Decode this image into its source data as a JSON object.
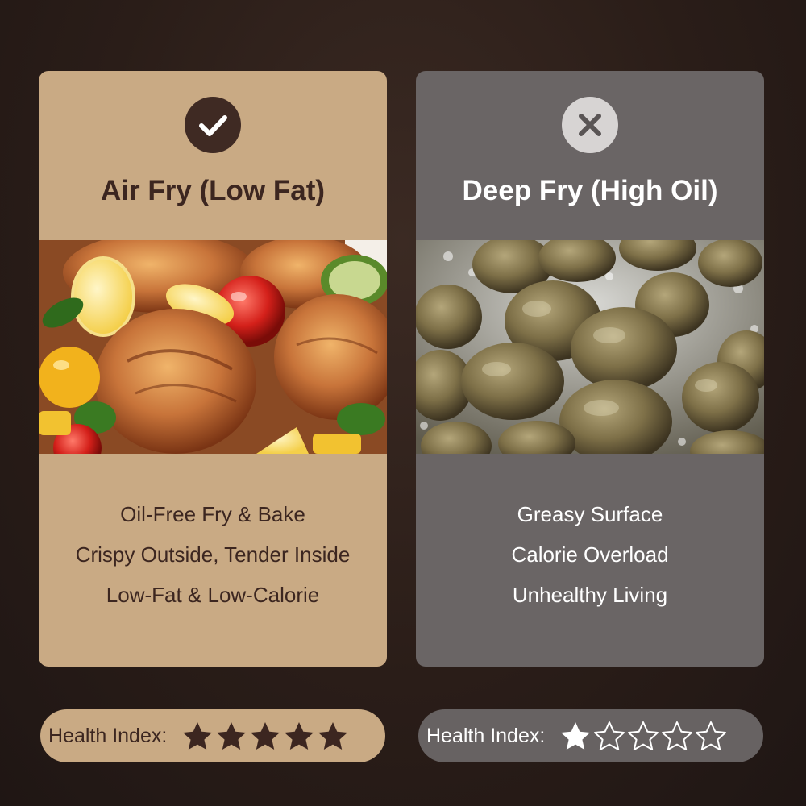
{
  "cards": {
    "good": {
      "badge_icon": "checkmark-icon",
      "title": "Air Fry (Low Fat)",
      "image_subject": "roasted-chicken-photo",
      "features": [
        "Oil-Free Fry & Bake",
        "Crispy Outside, Tender Inside",
        "Low-Fat & Low-Calorie"
      ],
      "accent_color": "#c9aa84",
      "text_color": "#3c2620"
    },
    "bad": {
      "badge_icon": "x-icon",
      "title": "Deep Fry (High Oil)",
      "image_subject": "deep-fried-balls-photo",
      "features": [
        "Greasy Surface",
        "Calorie Overload",
        "Unhealthy Living"
      ],
      "accent_color": "#6a6565",
      "text_color": "#ffffff"
    }
  },
  "ratings": {
    "good": {
      "label": "Health Index:",
      "stars_filled": 5,
      "stars_total": 5
    },
    "bad": {
      "label": "Health Index:",
      "stars_filled": 1,
      "stars_total": 5
    }
  }
}
